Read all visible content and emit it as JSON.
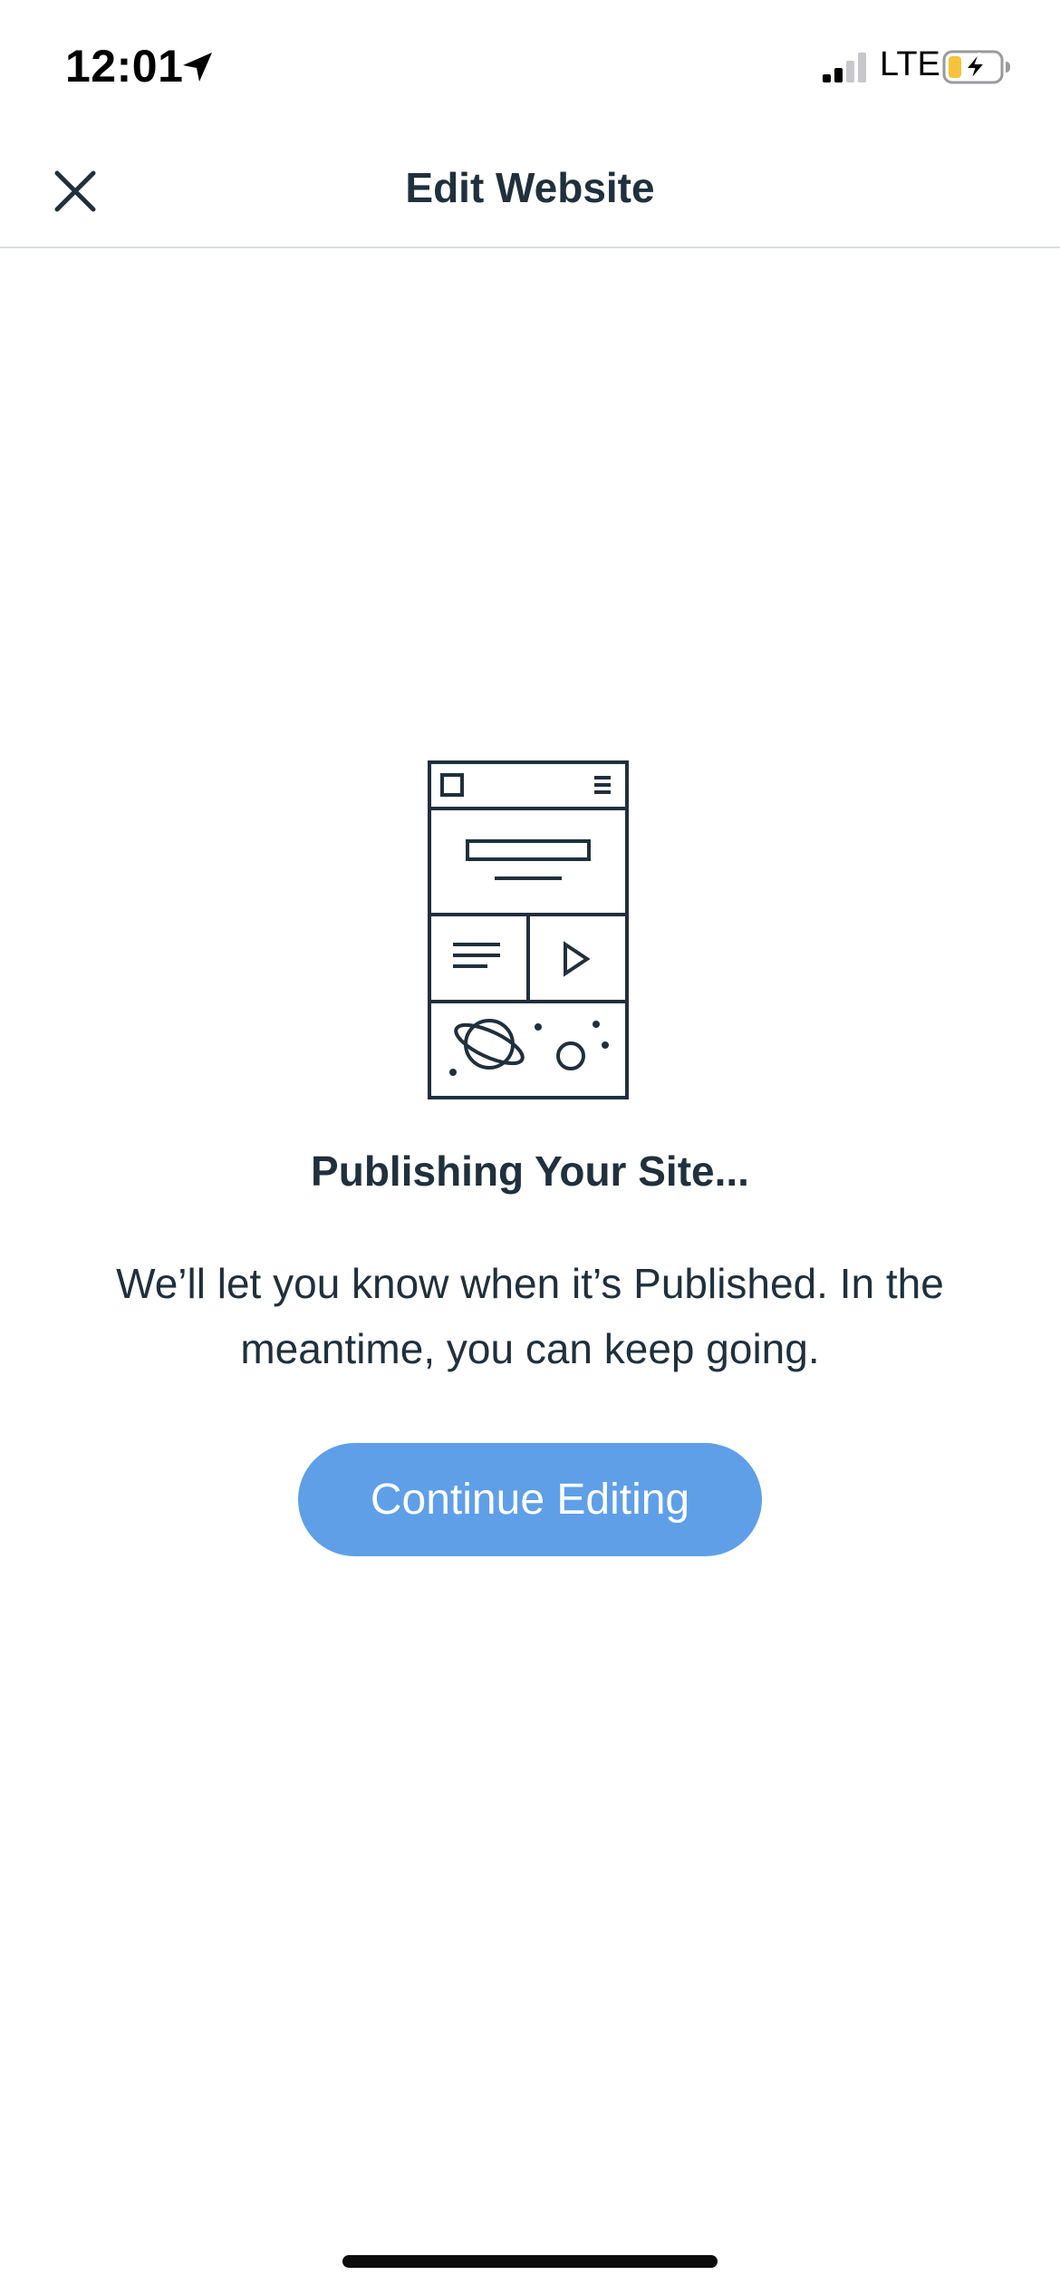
{
  "status_bar": {
    "time": "12:01",
    "network": "LTE",
    "icons": {
      "location": "location-arrow-icon",
      "signal": "cellular-signal-icon",
      "battery": "battery-charging-icon"
    }
  },
  "header": {
    "title": "Edit Website",
    "close_icon": "close-icon"
  },
  "content": {
    "illustration_icon": "website-publish-illustration-icon",
    "title": "Publishing Your Site...",
    "message": "We’ll let you know when it’s Published. In the meantime, you can keep going.",
    "button_label": "Continue Editing"
  },
  "colors": {
    "text": "#20303c",
    "button": "#5e9fe8",
    "button_text": "#ffffff",
    "divider": "#d9dde1",
    "battery_charge": "#f5c33b"
  }
}
